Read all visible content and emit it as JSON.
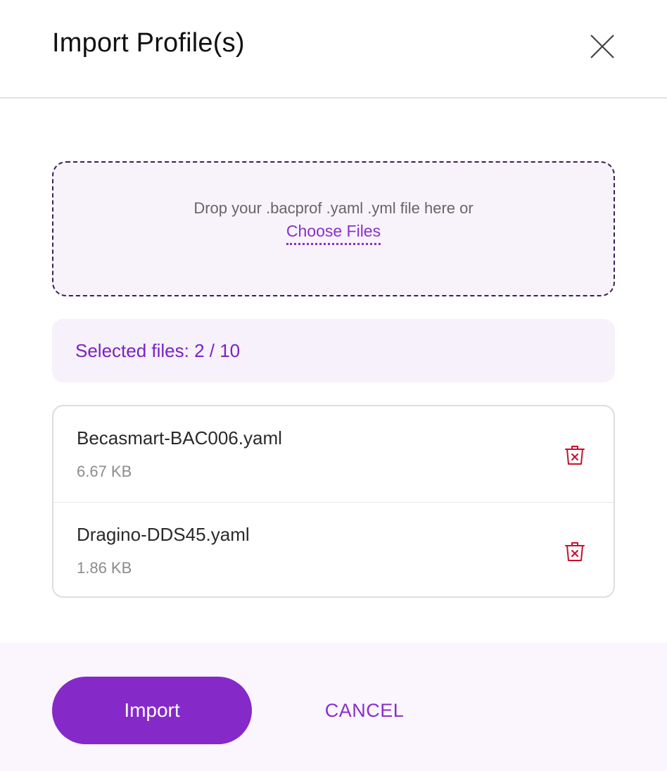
{
  "dialog": {
    "title": "Import Profile(s)",
    "close_icon": "close-icon"
  },
  "dropzone": {
    "text": "Drop your .bacprof .yaml .yml file here or",
    "link_label": "Choose Files"
  },
  "selected": {
    "text": "Selected files: 2 / 10"
  },
  "files": [
    {
      "name": "Becasmart-BAC006.yaml",
      "size": "6.67 KB",
      "icon": "trash-icon"
    },
    {
      "name": "Dragino-DDS45.yaml",
      "size": "1.86 KB",
      "icon": "trash-icon"
    }
  ],
  "footer": {
    "import_label": "Import",
    "cancel_label": "CANCEL"
  },
  "colors": {
    "accent": "#8629c9",
    "delete": "#c8102e",
    "dropzone_border": "#3b1f55"
  }
}
